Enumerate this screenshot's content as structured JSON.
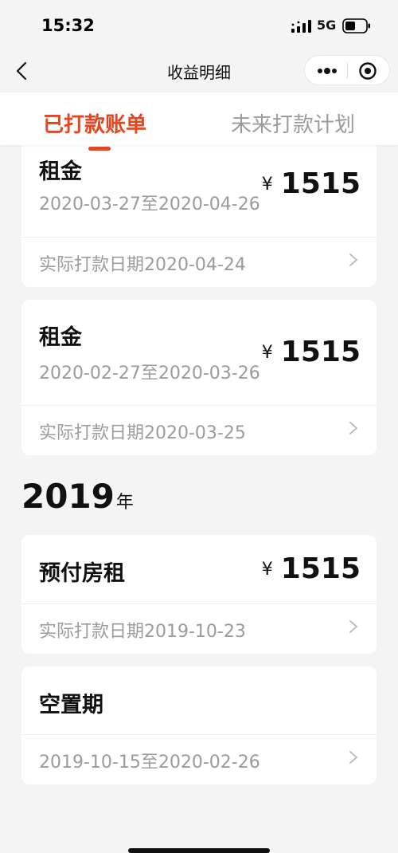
{
  "status_bar": {
    "time": "15:32",
    "network": "5G",
    "icons": [
      "signal-icon",
      "battery-icon"
    ]
  },
  "nav": {
    "title": "收益明细",
    "icons": [
      "back-icon",
      "more-icon",
      "target-icon"
    ]
  },
  "tabs": [
    {
      "label": "已打款账单",
      "active": true
    },
    {
      "label": "未来打款计划",
      "active": false
    }
  ],
  "colors": {
    "accent": "#e8441f",
    "muted_text": "#9b9b9b",
    "background": "#f4f4f4",
    "card": "#ffffff"
  },
  "currency_symbol": "¥",
  "records_2020": [
    {
      "title": "租金",
      "range": "2020-03-27至2020-04-26",
      "amount": "1515",
      "footer": "实际打款日期2020-04-24"
    },
    {
      "title": "租金",
      "range": "2020-02-27至2020-03-26",
      "amount": "1515",
      "footer": "实际打款日期2020-03-25"
    }
  ],
  "year_section": {
    "year": "2019",
    "unit": "年"
  },
  "records_2019": [
    {
      "title": "预付房租",
      "amount": "1515",
      "footer": "实际打款日期2019-10-23"
    },
    {
      "title": "空置期",
      "footer": "2019-10-15至2020-02-26"
    }
  ]
}
